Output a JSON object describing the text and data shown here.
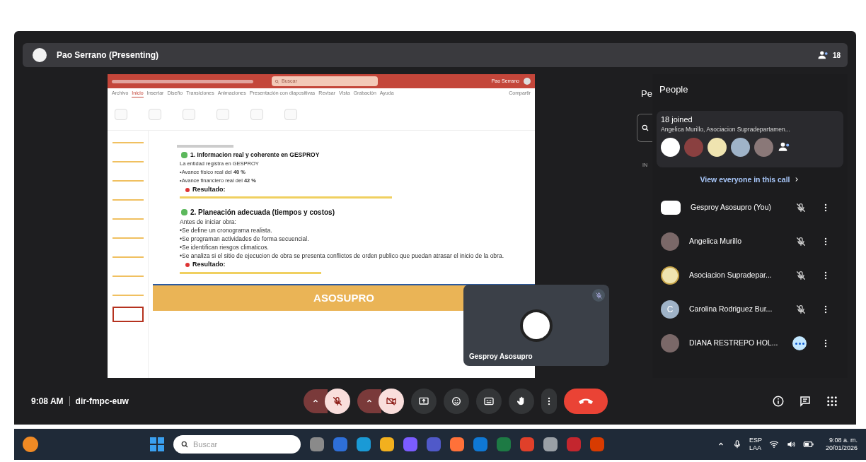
{
  "presenter_bar": {
    "title": "Pao Serrano (Presenting)",
    "people_count": "18"
  },
  "slide_window": {
    "search_placeholder": "Buscar",
    "user": "Pao Serrano",
    "ribbon_tabs": [
      {
        "label": "Archivo",
        "selected": false
      },
      {
        "label": "Inicio",
        "selected": true
      },
      {
        "label": "Insertar",
        "selected": false
      },
      {
        "label": "Diseño",
        "selected": false
      },
      {
        "label": "Transiciones",
        "selected": false
      },
      {
        "label": "Animaciones",
        "selected": false
      },
      {
        "label": "Presentación con diapositivas",
        "selected": false
      },
      {
        "label": "Revisar",
        "selected": false
      },
      {
        "label": "Vista",
        "selected": false
      },
      {
        "label": "Grabación",
        "selected": false
      },
      {
        "label": "Ayuda",
        "selected": false
      }
    ],
    "share_label": "Compartir",
    "thumbnails": [
      {
        "selected": false
      },
      {
        "selected": false
      },
      {
        "selected": false
      },
      {
        "selected": false
      },
      {
        "selected": false
      },
      {
        "selected": false
      },
      {
        "selected": false
      },
      {
        "selected": false
      },
      {
        "selected": false
      },
      {
        "selected": true
      }
    ],
    "slide": {
      "sections": [
        {
          "heading": "1. Informacion real y coherente en GESPROY",
          "lines": [
            "La entidad registra en GESPROY",
            "•Avance físico real del **40 %**",
            "•Avance financiero real del **42 %**"
          ],
          "result_label": "Resultado:"
        },
        {
          "heading": "2. Planeación adecuada (tiempos y costos)",
          "lines": [
            "Antes de iniciar obra:",
            "•Se define un cronograma realista.",
            "•Se programan actividades de forma secuencial.",
            "•Se identifican riesgos climaticos.",
            "•Se analiza si el sitio de ejecucion de obra se presenta conflictos de orden publico que puedan atrasar el inicio de la obra."
          ],
          "result_label": "Resultado:"
        }
      ],
      "banner": "ASOSUPRO"
    }
  },
  "self_view": {
    "name": "Gesproy Asosupro",
    "muted": true
  },
  "people_panel": {
    "title": "People",
    "joined": "18 joined",
    "joined_names": "Angelica Murillo, Asociacion Supradepartamen...",
    "view_all": "View everyone in this call",
    "participants": [
      {
        "name": "Gesproy Asosupro (You)",
        "kind": "logo",
        "muted": true
      },
      {
        "name": "Angelica Murillo",
        "kind": "photo",
        "muted": true
      },
      {
        "name": "Asociacion Supradepar...",
        "kind": "emblem",
        "muted": true
      },
      {
        "name": "Carolina Rodriguez Bur...",
        "kind": "letter",
        "letter": "C",
        "muted": true
      },
      {
        "name": "DIANA RESTREPO HOL...",
        "kind": "photo",
        "muted": false
      }
    ]
  },
  "behind_panel": {
    "title_fragment": "Pe",
    "section_fragment": "IN"
  },
  "call_bar": {
    "time": "9:08 AM",
    "meeting_code": "dir-fmpc-euw",
    "mic_on": false,
    "camera_on": false
  },
  "taskbar": {
    "search_placeholder": "Buscar",
    "language": "ESP",
    "layout": "LAA",
    "time": "9:08 a. m.",
    "date": "20/01/2026"
  }
}
